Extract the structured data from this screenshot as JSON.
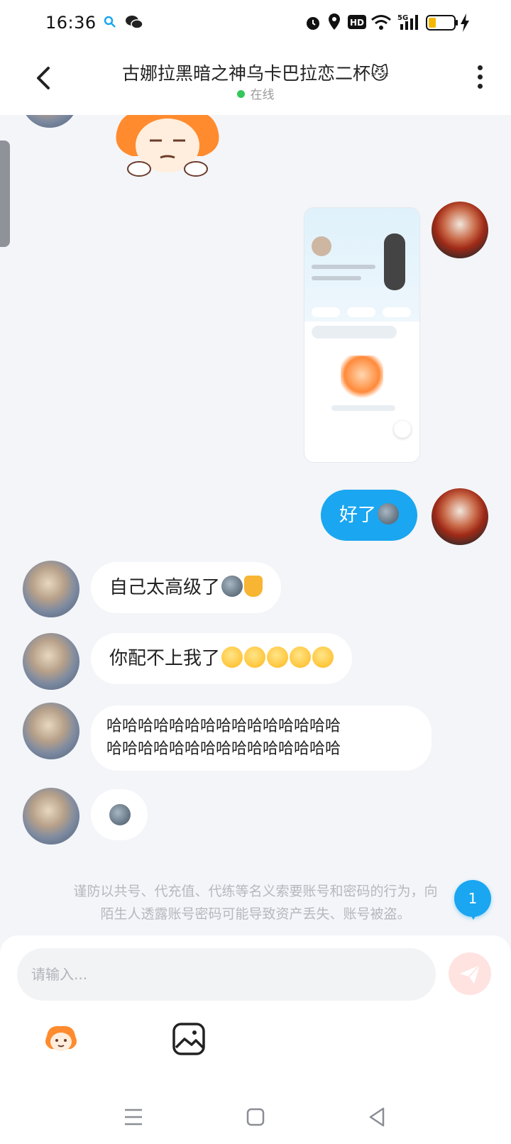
{
  "status_bar": {
    "time": "16:36",
    "battery_level": 0.3
  },
  "header": {
    "title": "古娜拉黑暗之神乌卡巴拉恋二杯😼",
    "status": "在线"
  },
  "messages": [
    {
      "from": "me",
      "type": "image"
    },
    {
      "from": "me",
      "text": "好了",
      "emoji": "new-moon-face"
    },
    {
      "from": "friend",
      "text": "自己太高级了",
      "emoji": [
        "new-moon-face",
        "thumbs-up"
      ]
    },
    {
      "from": "friend",
      "text": "你配不上我了",
      "emoji": [
        "eye-roll",
        "eye-roll",
        "eye-roll",
        "eye-roll",
        "eye-roll"
      ]
    },
    {
      "from": "friend",
      "line1": "哈哈哈哈哈哈哈哈哈哈哈哈哈哈哈",
      "line2": "哈哈哈哈哈哈哈哈哈哈哈哈哈哈哈"
    },
    {
      "from": "friend",
      "emoji": "new-moon-face"
    }
  ],
  "notice": {
    "line1": "谨防以共号、代充值、代练等名义索要账号和密码的行为，向",
    "line2": "陌生人透露账号密码可能导致资产丢失、账号被盗。"
  },
  "unread_count": "1",
  "composer": {
    "placeholder": "请输入..."
  },
  "colors": {
    "accent": "#1aa6f0",
    "online": "#34c759",
    "send_disabled": "#ffe3e1"
  }
}
